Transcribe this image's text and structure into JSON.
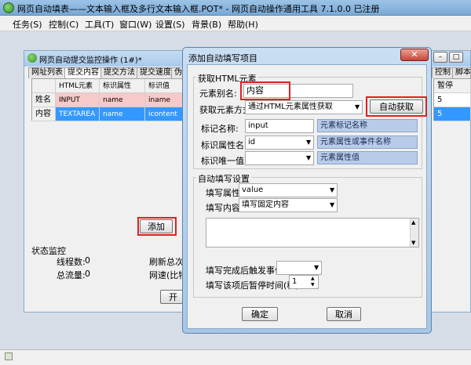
{
  "app": {
    "title": "网页自动填表——文本输入框及多行文本输入框.POT* - 网页自动操作通用工具 7.1.0.0  已注册"
  },
  "menu": [
    "任务(S)",
    "控制(C)",
    "工具(T)",
    "窗口(W)",
    "设置(S)",
    "背景(B)",
    "帮助(H)"
  ],
  "inner_window": {
    "title": "网页自动提交监控操作 (1#)*",
    "tabs": [
      "网址列表",
      "提交内容",
      "提交方法",
      "提交速度",
      "伪"
    ],
    "right_tabs": [
      "控制",
      "脚本"
    ],
    "grid_headers": [
      "HTML元素",
      "标识属性",
      "标识值"
    ],
    "rows": [
      {
        "name": "姓名",
        "elem": "INPUT",
        "attr": "name",
        "val": "iname"
      },
      {
        "name": "内容",
        "elem": "TEXTAREA",
        "attr": "name",
        "val": "icontent"
      }
    ],
    "pause_header": "暂停",
    "pause_values": [
      "5",
      "5"
    ],
    "add_button": "添加",
    "status": {
      "title": "状态监控",
      "threads_label": "线程数:",
      "threads_value": "0",
      "traffic_label": "总流量:",
      "traffic_value": "0",
      "refresh_label": "刷新总次数",
      "speed_label": "网速(比特",
      "start_button": "开始"
    }
  },
  "dialog": {
    "title": "添加自动填写项目",
    "section_get": "获取HTML元素",
    "alias_label": "元素别名:",
    "alias_value": "内容",
    "method_label": "获取元素方式",
    "method_value": "通过HTML元素属性获取",
    "auto_button": "自动获取",
    "tag_label": "标记名称:",
    "tag_value": "input",
    "tag_hint": "元素标记名称",
    "attr_label": "标识属性名:",
    "attr_value": "id",
    "attr_hint": "元素属性或事件名称",
    "unique_label": "标识唯一值:",
    "unique_value": "",
    "unique_hint": "元素属性值",
    "section_fill": "自动填写设置",
    "fill_attr_label": "填写属性:",
    "fill_attr_value": "value",
    "fill_content_label": "填写内容:",
    "fill_content_value": "填写固定内容",
    "trigger_label": "填写完成后触发事件",
    "trigger_value": "",
    "pause_label": "填写该项后暂停时间(秒)",
    "pause_value": "1",
    "ok_button": "确定",
    "cancel_button": "取消"
  }
}
